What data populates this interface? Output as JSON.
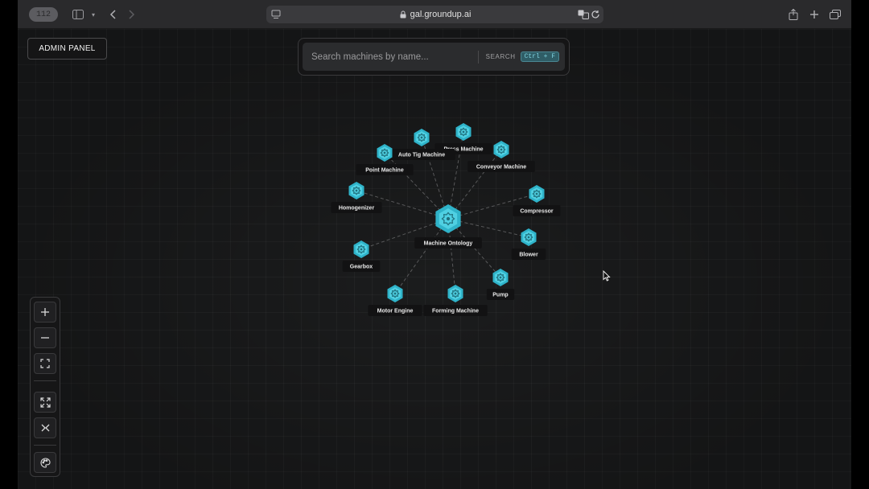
{
  "browser": {
    "tab_count": "112",
    "url": "gal.groundup.ai"
  },
  "app": {
    "admin_button": "ADMIN PANEL",
    "search": {
      "placeholder": "Search machines by name...",
      "button_label": "SEARCH",
      "shortcut": "Ctrl + F"
    },
    "graph": {
      "center": {
        "id": "center",
        "label": "Machine Ontology"
      },
      "nodes": [
        {
          "id": "n1",
          "label": "Press Machine"
        },
        {
          "id": "n2",
          "label": "Auto Tig Machine"
        },
        {
          "id": "n3",
          "label": "Conveyor Machine"
        },
        {
          "id": "n4",
          "label": "Point Machine"
        },
        {
          "id": "n5",
          "label": "Homogenizer"
        },
        {
          "id": "n6",
          "label": "Compressor"
        },
        {
          "id": "n7",
          "label": "Blower"
        },
        {
          "id": "n8",
          "label": "Gearbox"
        },
        {
          "id": "n9",
          "label": "Pump"
        },
        {
          "id": "n10",
          "label": "Motor Engine"
        },
        {
          "id": "n11",
          "label": "Forming Machine"
        }
      ]
    },
    "toolbar": {
      "zoom_in": "zoom-in",
      "zoom_out": "zoom-out",
      "fit_view": "fit-view",
      "expand": "expand",
      "collapse": "collapse",
      "theme": "palette"
    }
  },
  "colors": {
    "node_fill": "#2fb3c9",
    "node_highlight": "#4fd0e2",
    "background": "#1b1c1d"
  }
}
